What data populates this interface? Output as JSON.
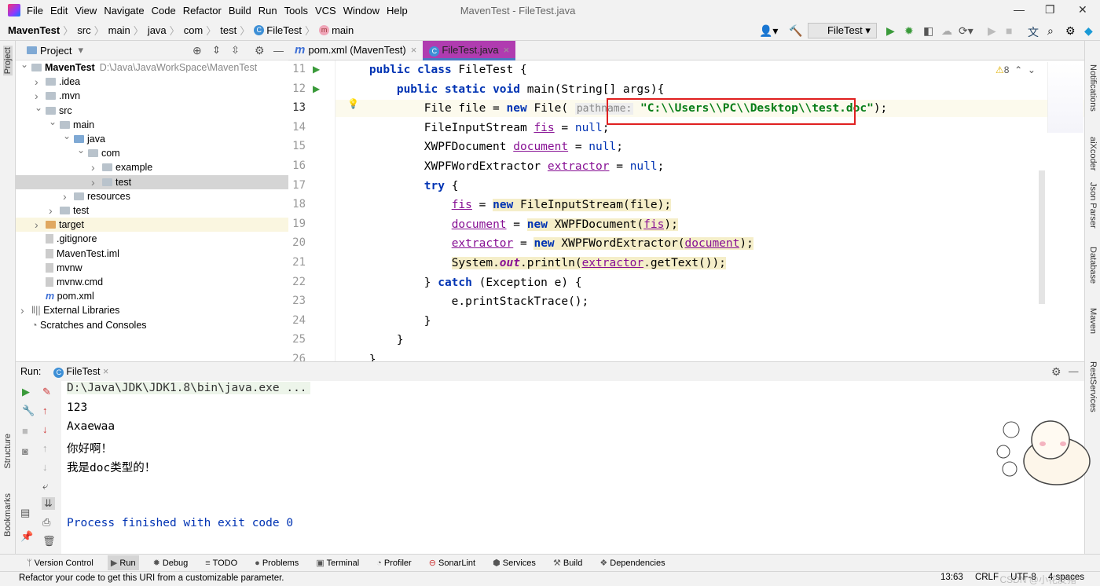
{
  "menubar": {
    "items": [
      "File",
      "Edit",
      "View",
      "Navigate",
      "Code",
      "Refactor",
      "Build",
      "Run",
      "Tools",
      "VCS",
      "Window",
      "Help"
    ],
    "title": "MavenTest - FileTest.java"
  },
  "breadcrumb": [
    "MavenTest",
    "src",
    "main",
    "java",
    "com",
    "test",
    "FileTest",
    "main"
  ],
  "toolbar": {
    "run_config": "FileTest"
  },
  "project": {
    "header": "Project",
    "tree": [
      {
        "label": "MavenTest",
        "path": "D:\\Java\\JavaWorkSpace\\MavenTest",
        "level": 0,
        "arrow": "open",
        "icon": "folder"
      },
      {
        "label": ".idea",
        "level": 1,
        "arrow": "closed",
        "icon": "folder"
      },
      {
        "label": ".mvn",
        "level": 1,
        "arrow": "closed",
        "icon": "folder"
      },
      {
        "label": "src",
        "level": 1,
        "arrow": "open",
        "icon": "folder"
      },
      {
        "label": "main",
        "level": 2,
        "arrow": "open",
        "icon": "folder"
      },
      {
        "label": "java",
        "level": 3,
        "arrow": "open",
        "icon": "folder-blue"
      },
      {
        "label": "com",
        "level": 4,
        "arrow": "open",
        "icon": "folder"
      },
      {
        "label": "example",
        "level": 5,
        "arrow": "closed",
        "icon": "folder"
      },
      {
        "label": "test",
        "level": 5,
        "arrow": "closed",
        "icon": "folder",
        "selected": true
      },
      {
        "label": "resources",
        "level": 3,
        "arrow": "closed",
        "icon": "folder"
      },
      {
        "label": "test",
        "level": 2,
        "arrow": "closed",
        "icon": "folder"
      },
      {
        "label": "target",
        "level": 1,
        "arrow": "closed",
        "icon": "folder-orange",
        "highlight": true
      },
      {
        "label": ".gitignore",
        "level": 1,
        "icon": "file"
      },
      {
        "label": "MavenTest.iml",
        "level": 1,
        "icon": "file"
      },
      {
        "label": "mvnw",
        "level": 1,
        "icon": "file"
      },
      {
        "label": "mvnw.cmd",
        "level": 1,
        "icon": "file"
      },
      {
        "label": "pom.xml",
        "level": 1,
        "icon": "maven-file"
      },
      {
        "label": "External Libraries",
        "level": 0,
        "arrow": "closed",
        "icon": "library"
      },
      {
        "label": "Scratches and Consoles",
        "level": 0,
        "icon": "scratch"
      }
    ]
  },
  "tabs": [
    {
      "label": "pom.xml (MavenTest)",
      "icon": "m"
    },
    {
      "label": "FileTest.java",
      "icon": "c",
      "active": true
    }
  ],
  "editor": {
    "warnings": "8",
    "current_line": 13,
    "lines": [
      {
        "n": "11",
        "t": [
          [
            "    ",
            ""
          ],
          [
            "public class ",
            "kw"
          ],
          [
            "FileTest {",
            ""
          ]
        ]
      },
      {
        "n": "12",
        "t": [
          [
            "        ",
            ""
          ],
          [
            "public static ",
            "kw"
          ],
          [
            "void ",
            "kw"
          ],
          [
            "main(String[] args){",
            ""
          ]
        ]
      },
      {
        "n": "13",
        "t": [
          [
            "            File file = ",
            ""
          ],
          [
            "new ",
            "kw"
          ],
          [
            "File( ",
            ""
          ],
          [
            "pathname:",
            "hint"
          ],
          [
            " ",
            ""
          ],
          [
            "\"C:\\\\Users\\\\PC\\\\Desktop\\\\test.doc\"",
            "str"
          ],
          [
            ");",
            ""
          ]
        ]
      },
      {
        "n": "14",
        "t": [
          [
            "            FileInputStream ",
            ""
          ],
          [
            "fis",
            "fld"
          ],
          [
            " = ",
            ""
          ],
          [
            "null",
            "nul"
          ],
          [
            ";",
            ""
          ]
        ]
      },
      {
        "n": "15",
        "t": [
          [
            "            XWPFDocument ",
            ""
          ],
          [
            "document",
            "fld"
          ],
          [
            " = ",
            ""
          ],
          [
            "null",
            "nul"
          ],
          [
            ";",
            ""
          ]
        ]
      },
      {
        "n": "16",
        "t": [
          [
            "            XWPFWordExtractor ",
            ""
          ],
          [
            "extractor",
            "fld"
          ],
          [
            " = ",
            ""
          ],
          [
            "null",
            "nul"
          ],
          [
            ";",
            ""
          ]
        ]
      },
      {
        "n": "17",
        "t": [
          [
            "            ",
            ""
          ],
          [
            "try ",
            "kw"
          ],
          [
            "{",
            ""
          ]
        ]
      },
      {
        "n": "18",
        "t": [
          [
            "                ",
            ""
          ],
          [
            "fis",
            "fld"
          ],
          [
            " = ",
            ""
          ],
          [
            "new ",
            "kw hl"
          ],
          [
            "FileInputStream(file);",
            "hl"
          ]
        ]
      },
      {
        "n": "19",
        "t": [
          [
            "                ",
            ""
          ],
          [
            "document",
            "fld"
          ],
          [
            " = ",
            ""
          ],
          [
            "new ",
            "kw hl"
          ],
          [
            "XWPFDocument(",
            "hl"
          ],
          [
            "fis",
            "fld hl"
          ],
          [
            ");",
            "hl"
          ]
        ]
      },
      {
        "n": "20",
        "t": [
          [
            "                ",
            ""
          ],
          [
            "extractor",
            "fld"
          ],
          [
            " = ",
            ""
          ],
          [
            "new ",
            "kw hl"
          ],
          [
            "XWPFWordExtractor(",
            "hl"
          ],
          [
            "document",
            "fld hl"
          ],
          [
            ");",
            "hl"
          ]
        ]
      },
      {
        "n": "21",
        "t": [
          [
            "                ",
            ""
          ],
          [
            "System.",
            "hl"
          ],
          [
            "out",
            "ital hl"
          ],
          [
            ".println(",
            "hl"
          ],
          [
            "extractor",
            "fld hl"
          ],
          [
            ".getText());",
            "hl"
          ]
        ]
      },
      {
        "n": "22",
        "t": [
          [
            "            } ",
            ""
          ],
          [
            "catch ",
            "kw"
          ],
          [
            "(Exception e) {",
            ""
          ]
        ]
      },
      {
        "n": "23",
        "t": [
          [
            "                e.printStackTrace();",
            ""
          ]
        ]
      },
      {
        "n": "24",
        "t": [
          [
            "            }",
            ""
          ]
        ]
      },
      {
        "n": "25",
        "t": [
          [
            "        }",
            ""
          ]
        ]
      },
      {
        "n": "26",
        "t": [
          [
            "    }",
            ""
          ]
        ]
      }
    ]
  },
  "run": {
    "label": "Run:",
    "tab": "FileTest",
    "output": [
      {
        "text": "D:\\Java\\JDK\\JDK1.8\\bin\\java.exe ...",
        "kind": "cmd"
      },
      {
        "text": "123"
      },
      {
        "text": "Axaewaa"
      },
      {
        "text": "你好啊！"
      },
      {
        "text": "我是doc类型的！"
      },
      {
        "text": ""
      },
      {
        "text": ""
      },
      {
        "text": "Process finished with exit code 0",
        "kind": "exit"
      }
    ]
  },
  "left_strip": [
    "Project",
    "Structure",
    "Bookmarks"
  ],
  "right_strip": [
    "Notifications",
    "aiXcoder",
    "Json Parser",
    "Database",
    "Maven",
    "RestServices"
  ],
  "bottom_tools": [
    "Version Control",
    "Run",
    "Debug",
    "TODO",
    "Problems",
    "Terminal",
    "Profiler",
    "SonarLint",
    "Services",
    "Build",
    "Dependencies"
  ],
  "status": {
    "message": "Refactor your code to get this URI from a customizable parameter.",
    "position": "13:63",
    "line_sep": "CRLF",
    "encoding": "UTF-8",
    "indent": "4 spaces",
    "watermark": "CSDN @小花皮猪"
  },
  "colors": {
    "accent_tab": "#b03cb0",
    "keyword": "#0033b3",
    "string": "#067d17",
    "field": "#871094",
    "highlight_box": "#e02020"
  }
}
